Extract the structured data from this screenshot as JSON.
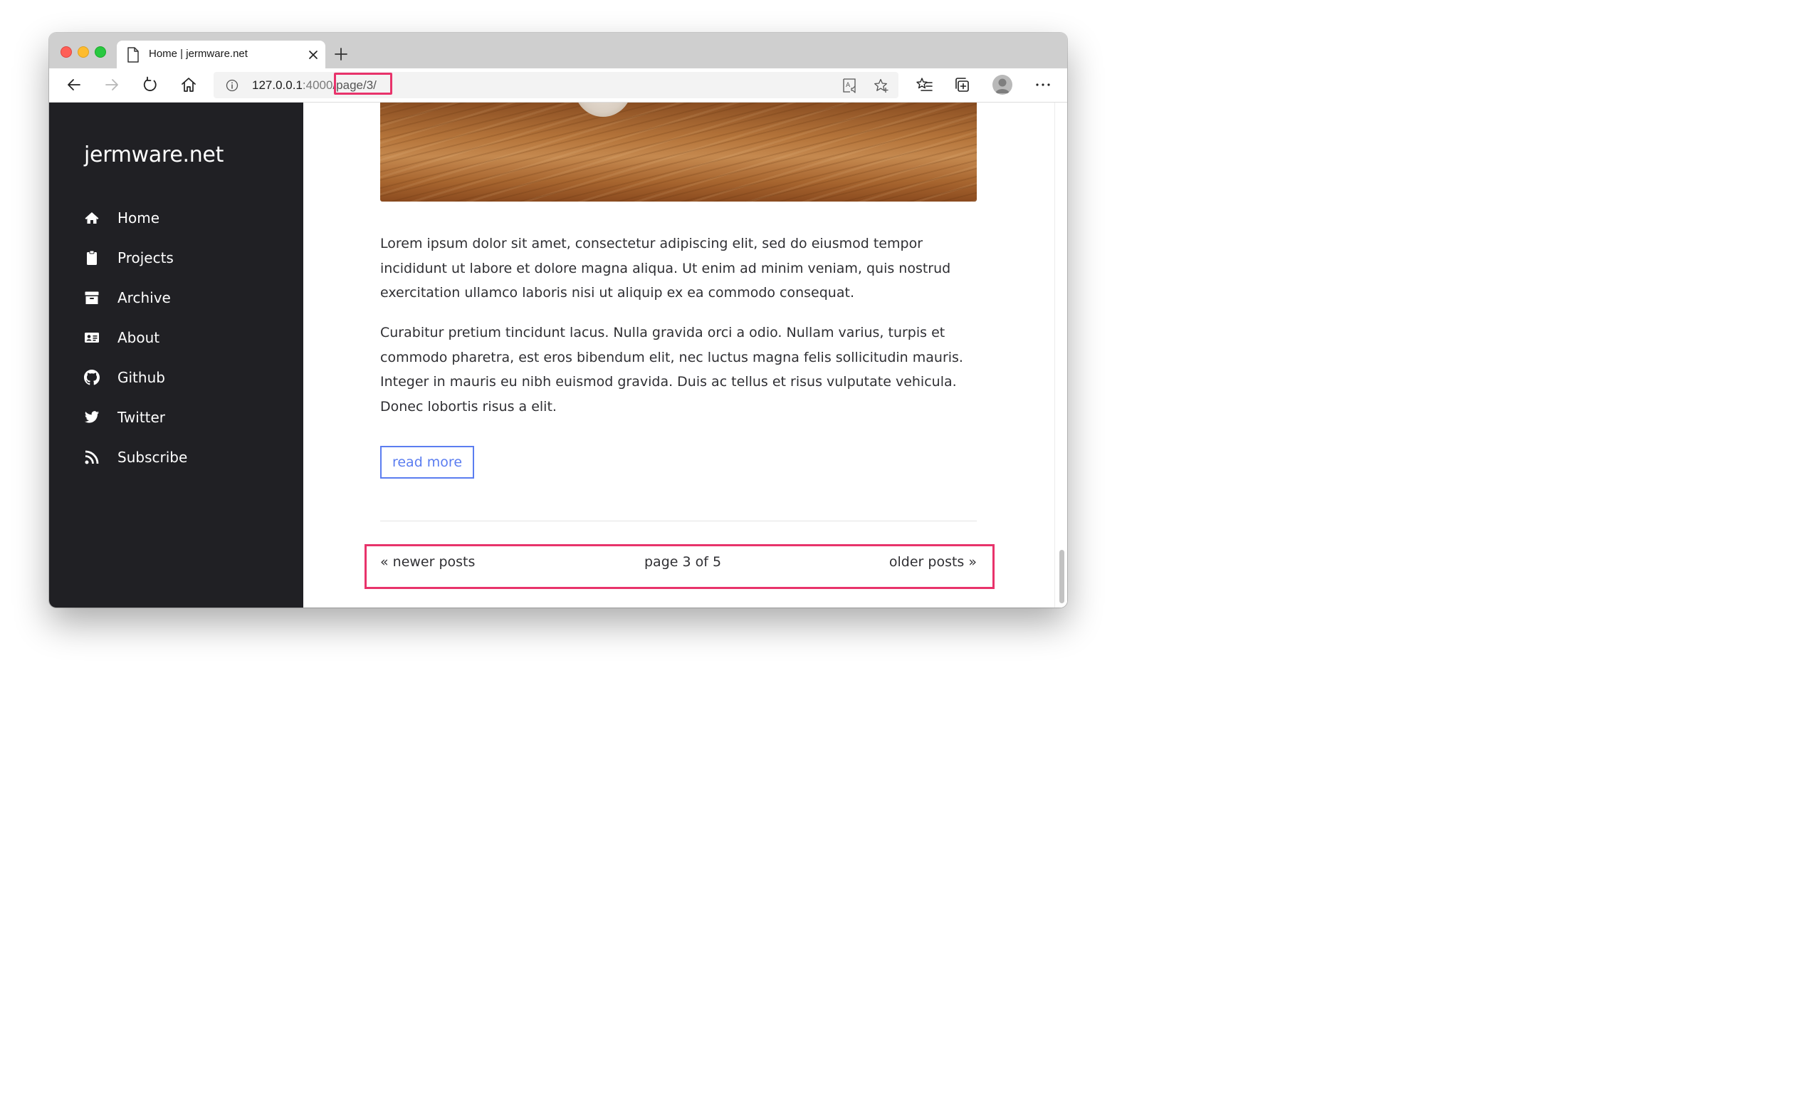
{
  "browser": {
    "tab_title": "Home | jermware.net",
    "url_host": "127.0.0.1",
    "url_port": ":4000",
    "url_path": "/page/3/"
  },
  "sidebar": {
    "brand": "jermware.net",
    "items": [
      {
        "label": "Home",
        "icon": "home-icon"
      },
      {
        "label": "Projects",
        "icon": "clipboard-icon"
      },
      {
        "label": "Archive",
        "icon": "archive-icon"
      },
      {
        "label": "About",
        "icon": "id-card-icon"
      },
      {
        "label": "Github",
        "icon": "github-icon"
      },
      {
        "label": "Twitter",
        "icon": "twitter-icon"
      },
      {
        "label": "Subscribe",
        "icon": "rss-icon"
      }
    ]
  },
  "post": {
    "paragraphs": [
      "Lorem ipsum dolor sit amet, consectetur adipiscing elit, sed do eiusmod tempor incididunt ut labore et dolore magna aliqua. Ut enim ad minim veniam, quis nostrud exercitation ullamco laboris nisi ut aliquip ex ea commodo consequat.",
      "Curabitur pretium tincidunt lacus. Nulla gravida orci a odio. Nullam varius, turpis et commodo pharetra, est eros bibendum elit, nec luctus magna felis sollicitudin mauris. Integer in mauris eu nibh euismod gravida. Duis ac tellus et risus vulputate vehicula. Donec lobortis risus a elit."
    ],
    "read_more": "read more"
  },
  "pagination": {
    "newer": "« newer posts",
    "page_info": "page 3 of 5",
    "older": "older posts »"
  },
  "colors": {
    "sidebar_bg": "#202024",
    "accent": "#5b7df0",
    "highlight": "#e8336b"
  }
}
